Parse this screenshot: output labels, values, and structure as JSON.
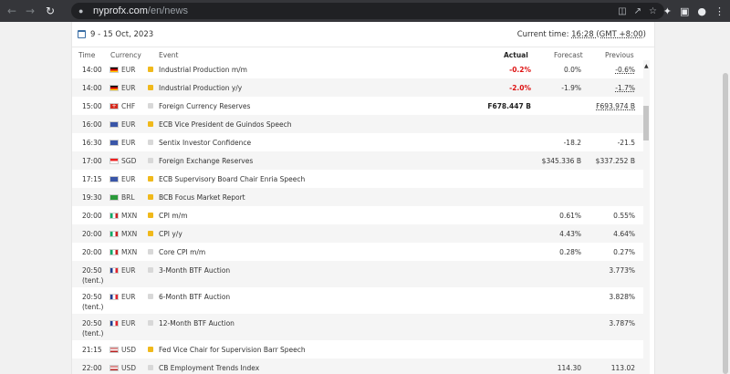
{
  "browser": {
    "url_host": "nyprofx.com",
    "url_path": "/en/news"
  },
  "header": {
    "date_range": "9 - 15 Oct, 2023",
    "current_time_label": "Current time:",
    "current_time_value": "16:28 (GMT +8:00)"
  },
  "columns": {
    "time": "Time",
    "currency": "Currency",
    "event": "Event",
    "actual": "Actual",
    "forecast": "Forecast",
    "previous": "Previous"
  },
  "rows": [
    {
      "time": "14:00",
      "time2": "",
      "currency": "EUR",
      "flag": "DE",
      "importance": "med",
      "event": "Industrial Production m/m",
      "actual": "-0.2%",
      "actual_style": "neg",
      "forecast": "0.0%",
      "previous": "-0.6%",
      "previous_style": "dotted"
    },
    {
      "time": "14:00",
      "time2": "",
      "currency": "EUR",
      "flag": "DE",
      "importance": "med",
      "event": "Industrial Production y/y",
      "actual": "-2.0%",
      "actual_style": "neg",
      "forecast": "-1.9%",
      "previous": "-1.7%",
      "previous_style": "dotted"
    },
    {
      "time": "15:00",
      "time2": "",
      "currency": "CHF",
      "flag": "CH",
      "importance": "low",
      "event": "Foreign Currency Reserves",
      "actual": "F678.447 B",
      "actual_style": "bold",
      "forecast": "",
      "previous": "F693.974 B",
      "previous_style": "dotted"
    },
    {
      "time": "16:00",
      "time2": "",
      "currency": "EUR",
      "flag": "EU",
      "importance": "med",
      "event": "ECB Vice President de Guindos Speech",
      "actual": "",
      "actual_style": "",
      "forecast": "",
      "previous": "",
      "previous_style": ""
    },
    {
      "time": "16:30",
      "time2": "",
      "currency": "EUR",
      "flag": "EU",
      "importance": "low",
      "event": "Sentix Investor Confidence",
      "actual": "",
      "actual_style": "",
      "forecast": "-18.2",
      "previous": "-21.5",
      "previous_style": ""
    },
    {
      "time": "17:00",
      "time2": "",
      "currency": "SGD",
      "flag": "SG",
      "importance": "low",
      "event": "Foreign Exchange Reserves",
      "actual": "",
      "actual_style": "",
      "forecast": "$345.336 B",
      "previous": "$337.252 B",
      "previous_style": ""
    },
    {
      "time": "17:15",
      "time2": "",
      "currency": "EUR",
      "flag": "EU",
      "importance": "med",
      "event": "ECB Supervisory Board Chair Enria Speech",
      "actual": "",
      "actual_style": "",
      "forecast": "",
      "previous": "",
      "previous_style": ""
    },
    {
      "time": "19:30",
      "time2": "",
      "currency": "BRL",
      "flag": "BR",
      "importance": "med",
      "event": "BCB Focus Market Report",
      "actual": "",
      "actual_style": "",
      "forecast": "",
      "previous": "",
      "previous_style": ""
    },
    {
      "time": "20:00",
      "time2": "",
      "currency": "MXN",
      "flag": "MX",
      "importance": "med",
      "event": "CPI m/m",
      "actual": "",
      "actual_style": "",
      "forecast": "0.61%",
      "previous": "0.55%",
      "previous_style": ""
    },
    {
      "time": "20:00",
      "time2": "",
      "currency": "MXN",
      "flag": "MX",
      "importance": "med",
      "event": "CPI y/y",
      "actual": "",
      "actual_style": "",
      "forecast": "4.43%",
      "previous": "4.64%",
      "previous_style": ""
    },
    {
      "time": "20:00",
      "time2": "",
      "currency": "MXN",
      "flag": "MX",
      "importance": "low",
      "event": "Core CPI m/m",
      "actual": "",
      "actual_style": "",
      "forecast": "0.28%",
      "previous": "0.27%",
      "previous_style": ""
    },
    {
      "time": "20:50",
      "time2": "(tent.)",
      "currency": "EUR",
      "flag": "FR",
      "importance": "low",
      "event": "3-Month BTF Auction",
      "actual": "",
      "actual_style": "",
      "forecast": "",
      "previous": "3.773%",
      "previous_style": ""
    },
    {
      "time": "20:50",
      "time2": "(tent.)",
      "currency": "EUR",
      "flag": "FR",
      "importance": "low",
      "event": "6-Month BTF Auction",
      "actual": "",
      "actual_style": "",
      "forecast": "",
      "previous": "3.828%",
      "previous_style": ""
    },
    {
      "time": "20:50",
      "time2": "(tent.)",
      "currency": "EUR",
      "flag": "FR",
      "importance": "low",
      "event": "12-Month BTF Auction",
      "actual": "",
      "actual_style": "",
      "forecast": "",
      "previous": "3.787%",
      "previous_style": ""
    },
    {
      "time": "21:15",
      "time2": "",
      "currency": "USD",
      "flag": "US",
      "importance": "med",
      "event": "Fed Vice Chair for Supervision Barr Speech",
      "actual": "",
      "actual_style": "",
      "forecast": "",
      "previous": "",
      "previous_style": ""
    },
    {
      "time": "22:00",
      "time2": "",
      "currency": "USD",
      "flag": "US",
      "importance": "low",
      "event": "CB Employment Trends Index",
      "actual": "",
      "actual_style": "",
      "forecast": "114.30",
      "previous": "113.02",
      "previous_style": ""
    }
  ],
  "colors": {
    "negative": "#dd1111",
    "medium_impact": "#f0b91b",
    "low_impact": "#d8d8d8"
  }
}
